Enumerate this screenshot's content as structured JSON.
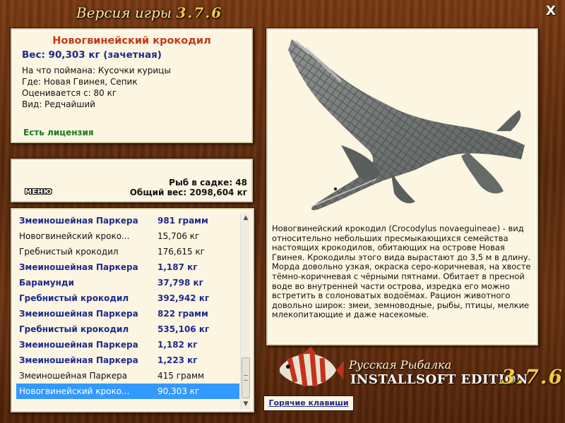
{
  "window": {
    "title_prefix": "Версия игры",
    "title_version": "3.7.6",
    "close_label": "X"
  },
  "info": {
    "name": "Новогвинейский крокодил",
    "weight": "Вес: 90,303 кг (зачетная)",
    "caught_on": "На что поймана: Кусочки курицы",
    "location": "Где: Новая Гвинея, Сепик",
    "valued_from": "Оценивается с: 80 кг",
    "kind": "Вид: Редчайший",
    "license": "Есть лицензия"
  },
  "cage": {
    "menu_label": "МЕНЮ",
    "count": "Рыб в садке: 48",
    "total_weight": "Общий вес: 2098,604 кг"
  },
  "catch_list": [
    {
      "name": "Змеиношейная Паркера",
      "weight": "981 грамм",
      "bold": true
    },
    {
      "name": "Новогвинейский кроко...",
      "weight": "15,706 кг",
      "bold": false
    },
    {
      "name": "Гребнистый крокодил",
      "weight": "176,615 кг",
      "bold": false
    },
    {
      "name": "Змеиношейная Паркера",
      "weight": "1,187 кг",
      "bold": true
    },
    {
      "name": "Барамунди",
      "weight": "37,798 кг",
      "bold": true
    },
    {
      "name": "Гребнистый крокодил",
      "weight": "392,942 кг",
      "bold": true
    },
    {
      "name": "Змеиношейная Паркера",
      "weight": "822 грамм",
      "bold": true
    },
    {
      "name": "Гребнистый крокодил",
      "weight": "535,106 кг",
      "bold": true
    },
    {
      "name": "Змеиношейная Паркера",
      "weight": "1,182 кг",
      "bold": true
    },
    {
      "name": "Змеиношейная Паркера",
      "weight": "1,223 кг",
      "bold": true
    },
    {
      "name": "Змеиношейная Паркера",
      "weight": "415 грамм",
      "bold": false
    },
    {
      "name": "Новогвинейский кроко...",
      "weight": "90,303 кг",
      "bold": false,
      "selected": true
    }
  ],
  "description": "Новогвинейский крокодил (Crocodylus novaeguineae) - вид относительно небольших пресмыкающихся семейства настоящих крокодилов, обитающих на острове Новая Гвинея. Крокодилы этого вида вырастают до 3,5 м в длину. Морда довольно узкая, окраска серо-коричневая, на хвосте тёмно-коричневая с чёрными пятнами. Обитает в пресной воде во внутренней части острова, изредка его можно встретить в солоноватых водоёмах. Рацион животного довольно широк: змеи, земноводные, рыбы, птицы, мелкие млекопитающие и даже насекомые.",
  "logo": {
    "title": "Русская Рыбалка",
    "edition": "INSTALLSOFT EDITION",
    "version": "3.7.6"
  },
  "hotkeys_label": "Горячие клавиши",
  "colors": {
    "accent_red": "#c0391b",
    "accent_blue": "#1d2a8c",
    "license_green": "#1c7a1c",
    "selection": "#3399ff"
  }
}
